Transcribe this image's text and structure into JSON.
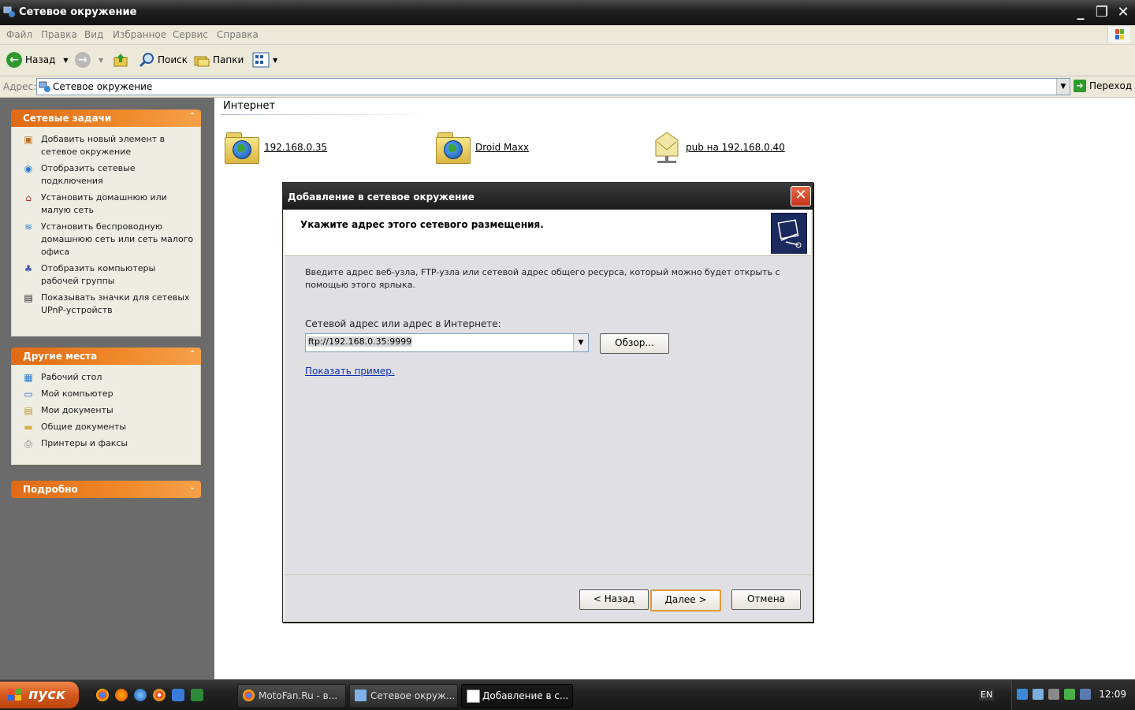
{
  "window": {
    "title": "Сетевое окружение",
    "minimize": "_",
    "maximize": "❐",
    "close": "✕"
  },
  "menu": [
    "Файл",
    "Правка",
    "Вид",
    "Избранное",
    "Сервис",
    "Справка"
  ],
  "toolbar": {
    "back_label": "Назад",
    "search_label": "Поиск",
    "folders_label": "Папки"
  },
  "address": {
    "label": "Адрес:",
    "value": "Сетевое окружение",
    "go_label": "Переход"
  },
  "left_pane": {
    "tasks": {
      "title": "Сетевые задачи",
      "items": [
        "Добавить новый элемент в сетевое окружение",
        "Отобразить сетевые подключения",
        "Установить домашнюю или малую сеть",
        "Установить беспроводную домашнюю сеть или сеть малого офиса",
        "Отобразить компьютеры рабочей группы",
        "Показывать значки для сетевых UPnP-устройств"
      ]
    },
    "places": {
      "title": "Другие места",
      "items": [
        "Рабочий стол",
        "Мой компьютер",
        "Мои документы",
        "Общие документы",
        "Принтеры и факсы"
      ]
    },
    "details": {
      "title": "Подробно"
    }
  },
  "content": {
    "group": "Интернет",
    "items": [
      "192.168.0.35",
      "Droid Maxx",
      "pub на 192.168.0.40"
    ]
  },
  "dialog": {
    "title": "Добавление в сетевое окружение",
    "heading": "Укажите адрес этого сетевого размещения.",
    "description": "Введите адрес веб-узла, FTP-узла или сетевой адрес общего ресурса, который можно будет открыть с помощью этого ярлыка.",
    "field_label": "Сетевой адрес или адрес в Интернете:",
    "field_value": "ftp://192.168.0.35:9999",
    "browse_label": "Обзор...",
    "example_link": "Показать пример.",
    "back_label": "< Назад",
    "next_label": "Далее >",
    "cancel_label": "Отмена"
  },
  "taskbar": {
    "start_label": "пуск",
    "tasks": [
      "MotoFan.Ru - в...",
      "Сетевое окруж...",
      "Добавление в с..."
    ],
    "language": "EN",
    "clock": "12:09"
  },
  "colors": {
    "panel_header": "#e06a14",
    "link": "#0b2fb0",
    "dialog_bg": "#e0dfe3",
    "start_button": "#d4581c"
  }
}
